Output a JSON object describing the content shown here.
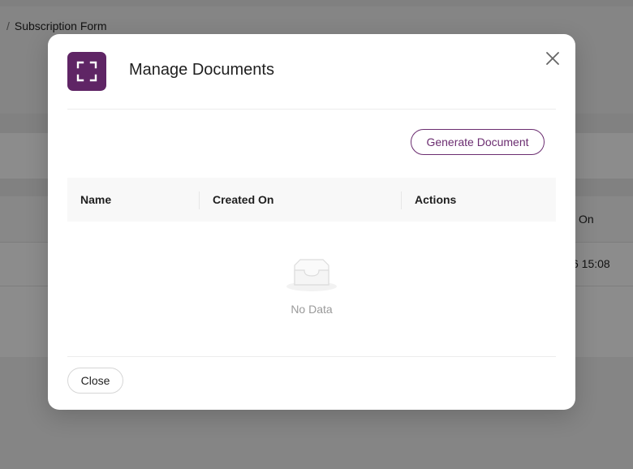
{
  "background_page": {
    "breadcrumb_separator": "/",
    "breadcrumb_current": "Subscription Form",
    "partial_column_header": "On",
    "partial_cell_value": "6 15:08"
  },
  "modal": {
    "icon": "expand-frame-icon",
    "title": "Manage Documents",
    "close_icon": "close-icon",
    "generate_button_label": "Generate Document",
    "table": {
      "columns": [
        "Name",
        "Created On",
        "Actions"
      ],
      "rows": []
    },
    "empty_state": {
      "icon": "empty-inbox-icon",
      "text": "No Data"
    },
    "footer_close_label": "Close"
  },
  "colors": {
    "accent": "#5f2565",
    "accent_text": "#6b2d70",
    "overlay": "rgba(0,0,0,0.45)",
    "muted_text": "#9a9a9a"
  }
}
